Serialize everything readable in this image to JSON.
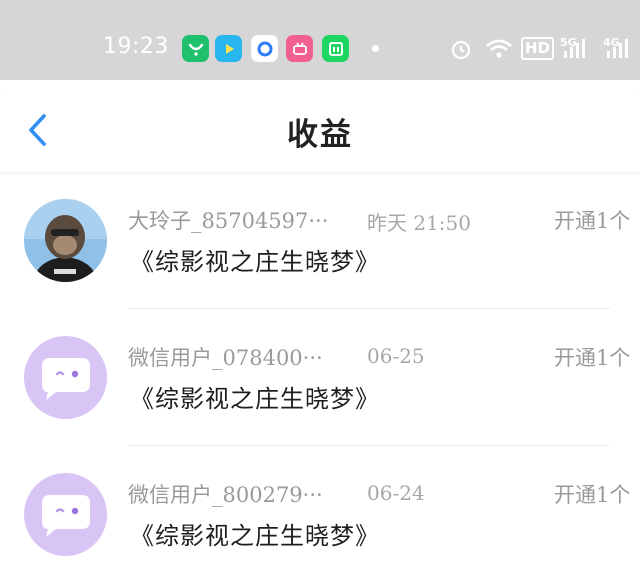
{
  "status_bar": {
    "time": "19:23",
    "apps": [
      "wechat-icon",
      "video-app-icon",
      "browser-icon",
      "bilibili-icon",
      "iqiyi-icon"
    ],
    "icons": [
      "alarm-icon",
      "wifi-icon",
      "hd-icon",
      "signal-5g-icon",
      "signal-4g-icon"
    ],
    "hd_label": "HD",
    "net1": "5G",
    "net2": "4G"
  },
  "header": {
    "title": "收益"
  },
  "rows": [
    {
      "username": "大玲子_85704597···",
      "time": "昨天 21:50",
      "action": "开通1个",
      "content": "《综影视之庄生晓梦》",
      "avatar": "monkey-avatar"
    },
    {
      "username": "微信用户_078400···",
      "time": "06-25",
      "action": "开通1个",
      "content": "《综影视之庄生晓梦》",
      "avatar": "chat-bubble-avatar"
    },
    {
      "username": "微信用户_800279···",
      "time": "06-24",
      "action": "开通1个",
      "content": "《综影视之庄生晓梦》",
      "avatar": "chat-bubble-avatar"
    }
  ],
  "colors": {
    "avatar_purple": "#d9c5f5",
    "back_arrow": "#2f8ff2"
  }
}
